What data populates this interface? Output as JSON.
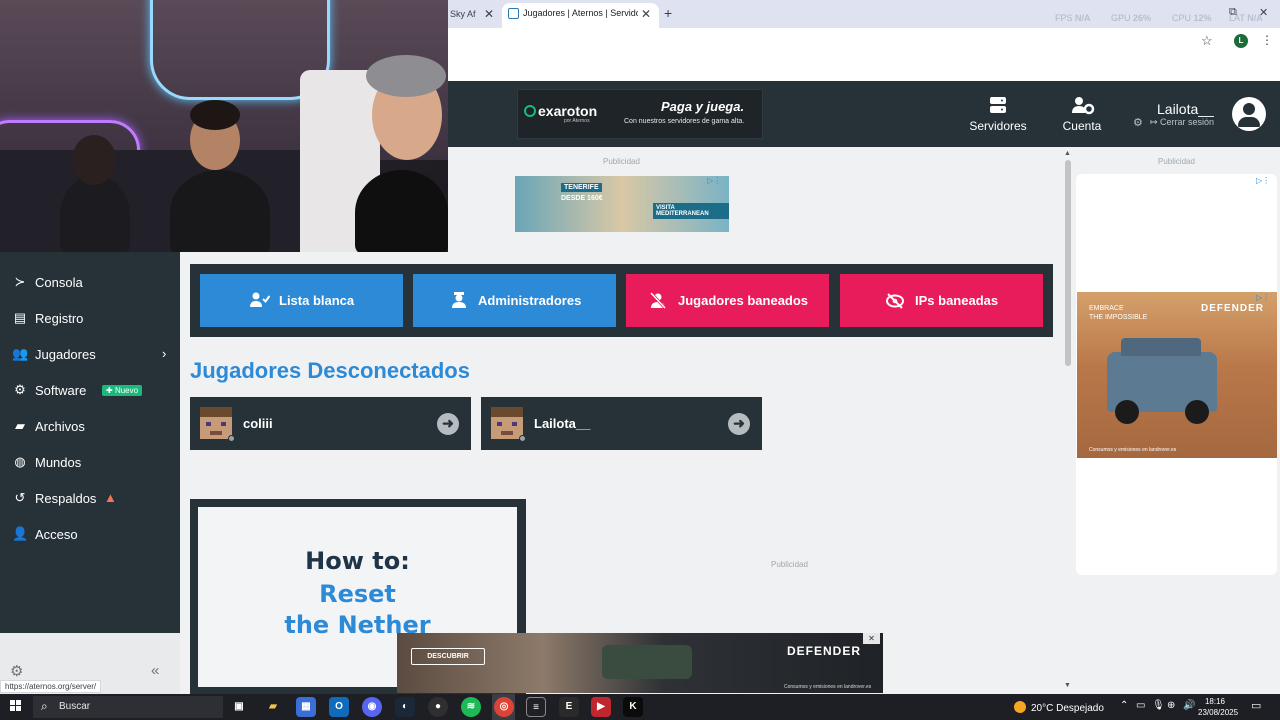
{
  "browser": {
    "inactive_tab_title": "Sky Af",
    "active_tab_title": "Jugadores | Aternos | Servidor de",
    "new_tab": "+",
    "close_glyph": "✕",
    "stats": {
      "fps_label": "FPS",
      "fps_value": "N/A",
      "gpu_label": "GPU",
      "gpu_value": "26%",
      "cpu_label": "CPU",
      "cpu_value": "12%",
      "lat_label": "LAT",
      "lat_value": "N/A"
    },
    "profile_initial": "L"
  },
  "header": {
    "promo": {
      "brand": "exaroton",
      "brand_sub": "por Aternos",
      "headline": "Paga y juega.",
      "tagline": "Con nuestros servidores de gama alta."
    },
    "nav": [
      {
        "label": "Servidores",
        "icon": "servers-icon"
      },
      {
        "label": "Cuenta",
        "icon": "account-settings-icon"
      }
    ],
    "user": {
      "name": "Lailota__",
      "logout": "Cerrar sesión"
    }
  },
  "sidebar": {
    "items": [
      {
        "label": "Consola",
        "icon": "console-icon",
        "glyph": "≻"
      },
      {
        "label": "Registro",
        "icon": "log-file-icon",
        "glyph": "▤"
      },
      {
        "label": "Jugadores",
        "icon": "players-icon",
        "glyph": "👥",
        "chevron": "›"
      },
      {
        "label": "Software",
        "icon": "software-gear-icon",
        "glyph": "⚙",
        "badge": "Nuevo"
      },
      {
        "label": "Archivos",
        "icon": "folder-icon",
        "glyph": "▰"
      },
      {
        "label": "Mundos",
        "icon": "globe-icon",
        "glyph": "◍"
      },
      {
        "label": "Respaldos",
        "icon": "backup-history-icon",
        "glyph": "↺",
        "warning": "▲"
      },
      {
        "label": "Acceso",
        "icon": "user-access-icon",
        "glyph": "👤"
      }
    ],
    "collapse_glyph": "«",
    "settings_glyph": "⚙",
    "status_url": "https://aternos.org/server/"
  },
  "ads": {
    "label": "Publicidad",
    "mid_banner": {
      "tag": "TENERIFE",
      "price": "DESDE 160€",
      "cta": "VISITA MEDITERRANEAN"
    },
    "right_banner": {
      "small_text_1": "EMBRACE",
      "small_text_2": "THE IMPOSSIBLE",
      "brand": "DEFENDER",
      "footer": "Consumos y emisiones en landrover.es"
    },
    "bottom_banner": {
      "cta": "DESCUBRIR",
      "brand": "DEFENDER",
      "footer": "Consumos y emisiones en landrover.es",
      "close": "✕"
    }
  },
  "main": {
    "action_buttons": [
      {
        "label": "Lista blanca",
        "icon": "whitelist-icon",
        "color": "#2d8ad6"
      },
      {
        "label": "Administradores",
        "icon": "admin-icon",
        "color": "#2d8ad6"
      },
      {
        "label": "Jugadores baneados",
        "icon": "banned-players-icon",
        "color": "#e81c5a"
      },
      {
        "label": "IPs baneadas",
        "icon": "banned-ips-icon",
        "color": "#e81c5a"
      }
    ],
    "section_title": "Jugadores Desconectados",
    "players": [
      {
        "name": "coliii",
        "status": "offline"
      },
      {
        "name": "Lailota__",
        "status": "offline"
      }
    ],
    "howto": {
      "line1": "How to:",
      "line2": "Reset",
      "line3": "the Nether"
    }
  },
  "taskbar": {
    "search_label": "Buscar",
    "weather": "20°C  Despejado",
    "notification_count": "3",
    "time": "18:16",
    "date": "23/08/2025",
    "apps": [
      "task-view",
      "file-explorer",
      "store",
      "outlook",
      "discord",
      "steam",
      "obs",
      "spotify",
      "chrome",
      "notes",
      "epic-games",
      "videos",
      "kick"
    ]
  }
}
